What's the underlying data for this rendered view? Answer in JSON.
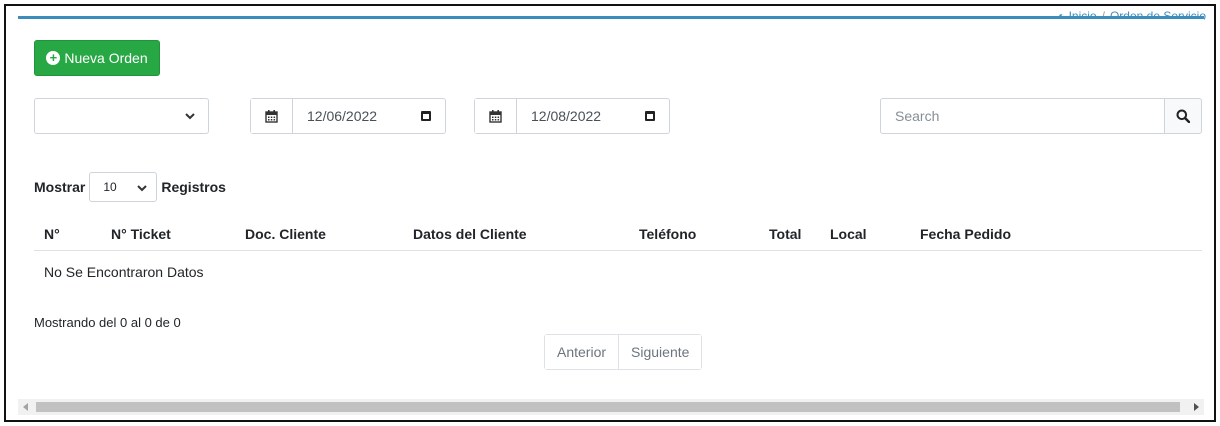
{
  "breadcrumb": {
    "home": "Inicio",
    "current": "Orden de Servicio",
    "separator": "/"
  },
  "toolbar": {
    "new_label": "Nueva Orden"
  },
  "filters": {
    "status_value": "",
    "date_from": "12/06/2022",
    "date_to": "12/08/2022",
    "search_placeholder": "Search"
  },
  "length": {
    "before": "Mostrar",
    "value": "10",
    "after": "Registros"
  },
  "table": {
    "headers": [
      "N°",
      "N° Ticket",
      "Doc. Cliente",
      "Datos del Cliente",
      "Teléfono",
      "Total",
      "Local",
      "Fecha Pedido"
    ],
    "empty_message": "No Se Encontraron Datos"
  },
  "footer": {
    "info": "Mostrando del 0 al 0 de 0",
    "prev": "Anterior",
    "next": "Siguiente"
  },
  "colors": {
    "primary": "#3c8dbc",
    "success": "#28a745"
  },
  "icons": {
    "new": "plus-circle-icon",
    "date": "calendar-icon",
    "search": "search-icon"
  }
}
